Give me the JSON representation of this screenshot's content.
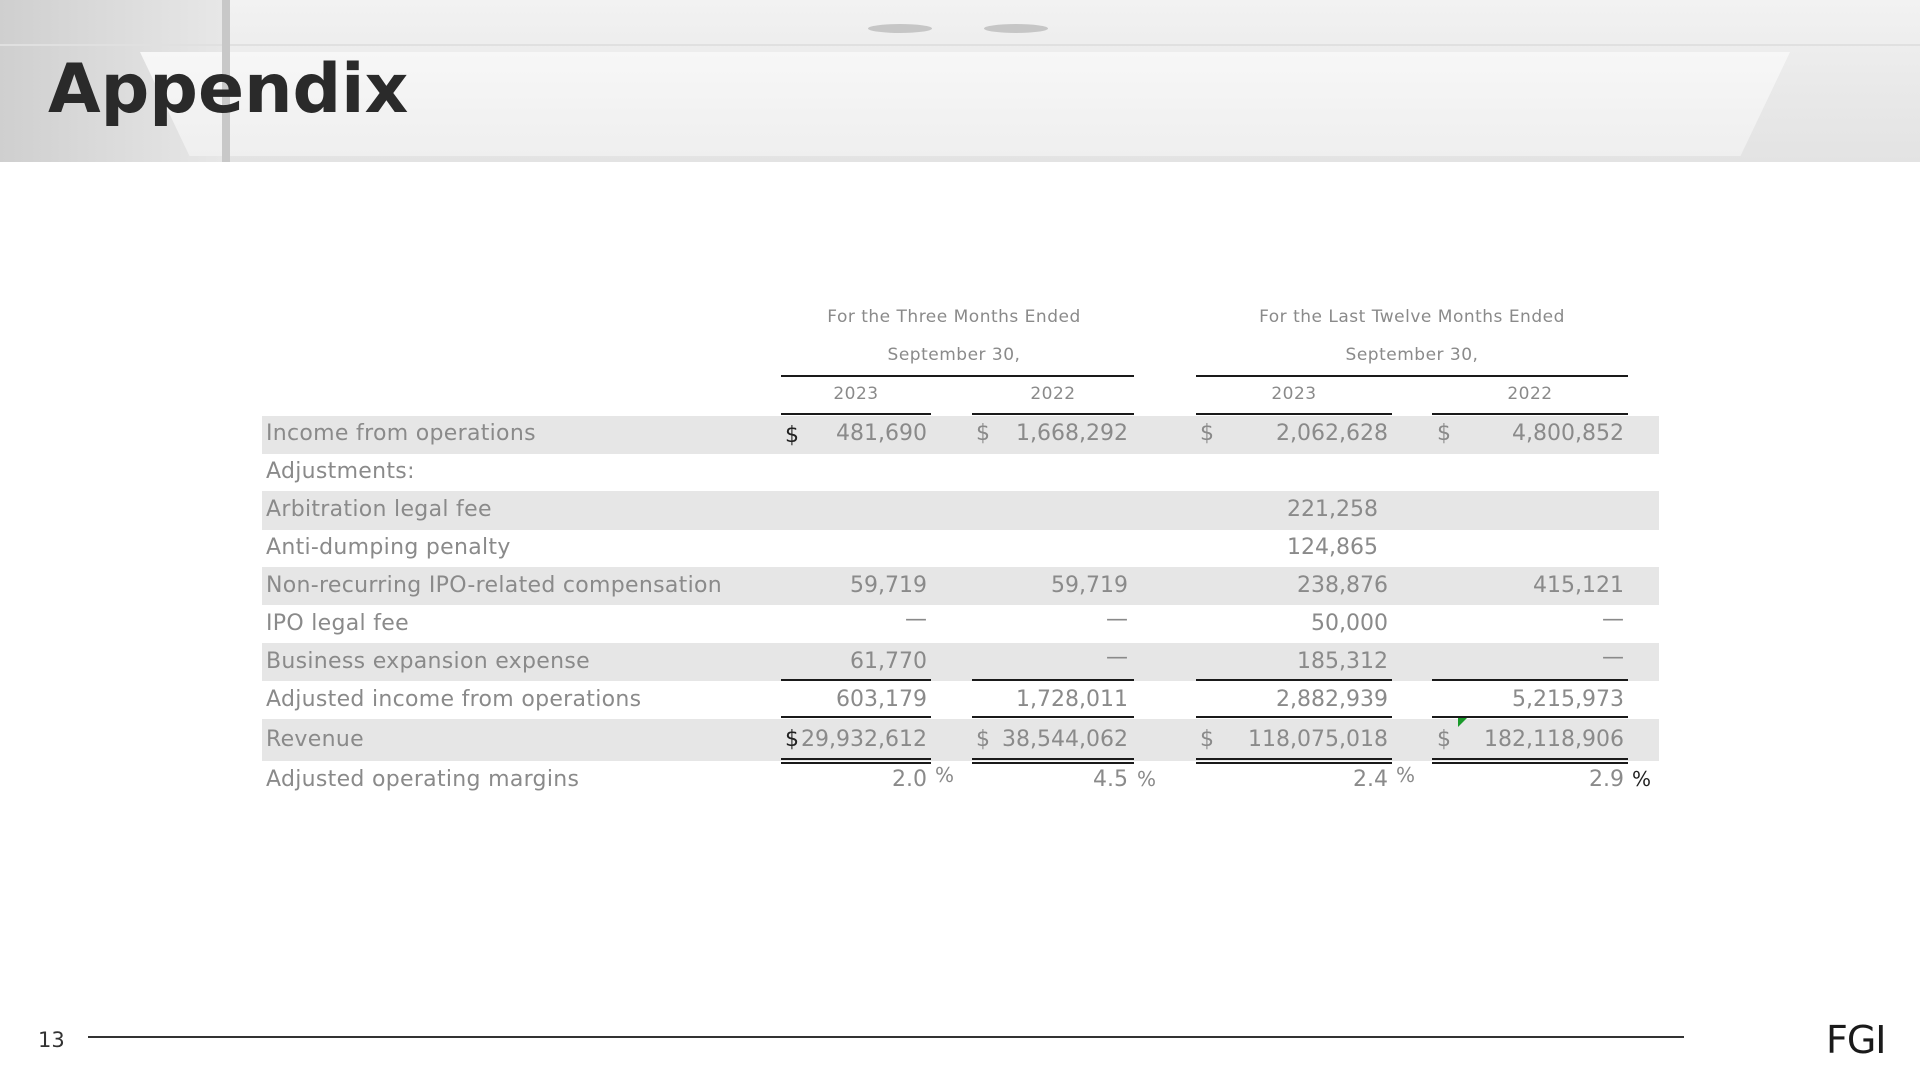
{
  "page": {
    "title": "Appendix",
    "page_number": "13",
    "logo_text": "FGI"
  },
  "table": {
    "group_headers": [
      {
        "line1": "For the Three Months Ended",
        "line2": "September 30,"
      },
      {
        "line1": "For the Last Twelve Months Ended",
        "line2": "September 30,"
      }
    ],
    "years": [
      "2023",
      "2022",
      "2023",
      "2022"
    ],
    "rows": [
      {
        "label": "Income from operations",
        "values": [
          "481,690",
          "1,668,292",
          "2,062,628",
          "4,800,852"
        ],
        "dollar": [
          "$",
          "$",
          "$",
          "$"
        ]
      },
      {
        "label": "Adjustments:",
        "values": [
          "",
          "",
          "",
          ""
        ]
      },
      {
        "label": "Arbitration legal fee",
        "values": [
          "",
          "",
          "221,258",
          ""
        ]
      },
      {
        "label": "Anti-dumping penalty",
        "values": [
          "",
          "",
          "124,865",
          ""
        ]
      },
      {
        "label": "Non-recurring IPO-related compensation",
        "values": [
          "59,719",
          "59,719",
          "238,876",
          "415,121"
        ]
      },
      {
        "label": "IPO legal fee",
        "values": [
          "—",
          "—",
          "50,000",
          "—"
        ]
      },
      {
        "label": "Business expansion expense",
        "values": [
          "61,770",
          "—",
          "185,312",
          "—"
        ]
      },
      {
        "label": "Adjusted income from operations",
        "values": [
          "603,179",
          "1,728,011",
          "2,882,939",
          "5,215,973"
        ]
      },
      {
        "label": "Revenue",
        "values": [
          "29,932,612",
          "38,544,062",
          "118,075,018",
          "182,118,906"
        ],
        "dollar": [
          "$",
          "$",
          "$",
          "$"
        ]
      },
      {
        "label": "Adjusted operating margins",
        "values": [
          "2.0",
          "4.5",
          "2.4",
          "2.9"
        ],
        "suffix": [
          "%",
          "%",
          "%",
          "%"
        ]
      }
    ]
  },
  "colors": {
    "band": "#e6e6e6",
    "text": "#8a8a8a",
    "title": "#2a2a2a",
    "rule": "#1a1a1a",
    "marker": "#1a9a2a"
  }
}
